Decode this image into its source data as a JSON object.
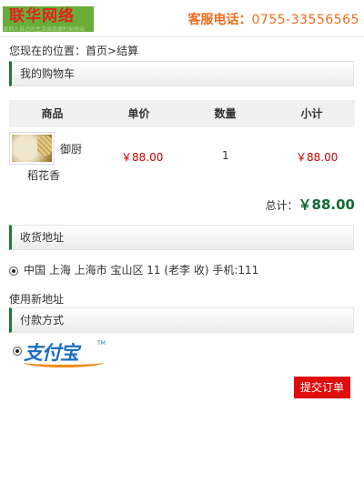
{
  "header": {
    "logo_title": "联华网络",
    "logo_subtitle": "深圳人自己的生活食品便利采购站",
    "phone_label": "客服电话：",
    "phone_number": "0755-33556565"
  },
  "breadcrumb": {
    "prefix": "您现在的位置：",
    "home": "首页",
    "sep": ">",
    "current": "结算"
  },
  "cart": {
    "section_title": "我的购物车",
    "columns": [
      "商品",
      "单价",
      "数量",
      "小计"
    ],
    "items": [
      {
        "name_line1": "御厨",
        "name_line2": "稻花香",
        "price": "￥88.00",
        "qty": "1",
        "subtotal": "￥88.00"
      }
    ],
    "total_label": "总计：",
    "total_value": "￥88.00"
  },
  "shipping": {
    "section_title": "收货地址",
    "address": "中国 上海 上海市 宝山区 11 (老李 收) 手机:111",
    "new_address_link": "使用新地址"
  },
  "payment": {
    "section_title": "付款方式",
    "method_logo_text": "支付宝",
    "method_logo_tm": "TM"
  },
  "actions": {
    "submit_label": "提交订单"
  },
  "colors": {
    "accent_green": "#1a7a36",
    "price_red": "#cc0000",
    "phone_orange": "#ee6b1a",
    "submit_red": "#e00d0d"
  }
}
